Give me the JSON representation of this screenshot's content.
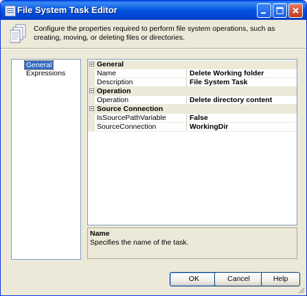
{
  "window": {
    "title": "File System Task Editor",
    "controls": {
      "minimize": "minimize-icon",
      "maximize": "maximize-icon",
      "close": "close-icon"
    }
  },
  "header": {
    "icon": "file-system-task-icon",
    "description": "Configure the properties required to perform file system operations, such as creating, moving, or deleting files or directories."
  },
  "nav": {
    "items": [
      {
        "label": "General",
        "selected": true
      },
      {
        "label": "Expressions",
        "selected": false
      }
    ]
  },
  "grid": {
    "categories": [
      {
        "label": "General",
        "properties": [
          {
            "name": "Name",
            "value": "Delete Working folder"
          },
          {
            "name": "Description",
            "value": "File System Task"
          }
        ]
      },
      {
        "label": "Operation",
        "properties": [
          {
            "name": "Operation",
            "value": "Delete directory content"
          }
        ]
      },
      {
        "label": "Source Connection",
        "properties": [
          {
            "name": "IsSourcePathVariable",
            "value": "False"
          },
          {
            "name": "SourceConnection",
            "value": "WorkingDir"
          }
        ]
      }
    ]
  },
  "help": {
    "title": "Name",
    "text": "Specifies the name of the task."
  },
  "buttons": {
    "ok": "OK",
    "cancel": "Cancel",
    "help": "Help"
  },
  "colors": {
    "titlebar": "#0054e3",
    "selection": "#316ac5",
    "dialog_bg": "#ece9d8"
  }
}
